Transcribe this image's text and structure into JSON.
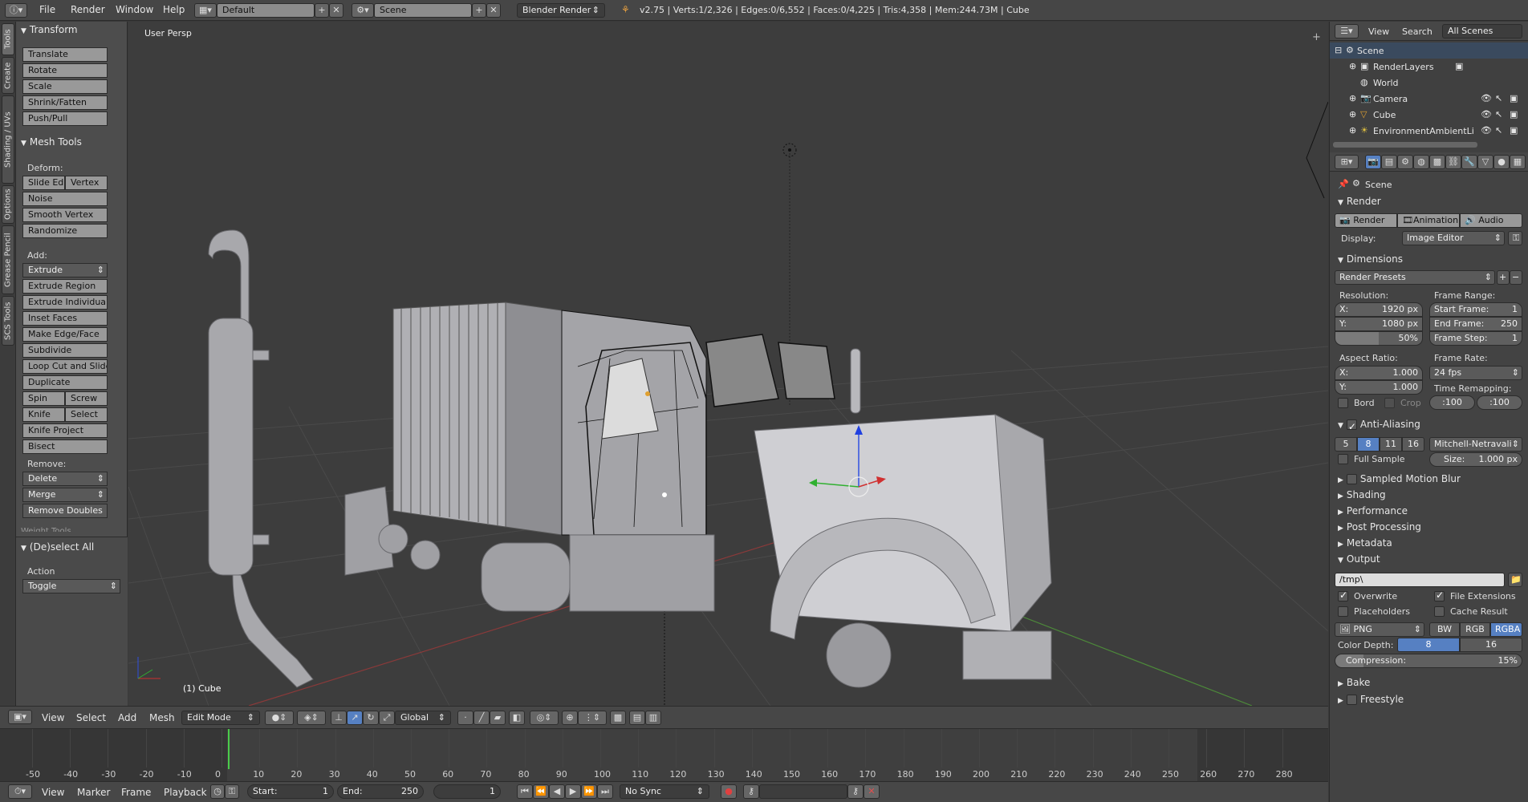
{
  "topbar": {
    "menus": [
      "File",
      "Render",
      "Window",
      "Help"
    ],
    "layout": "Default",
    "scene": "Scene",
    "engine": "Blender Render",
    "stats": "v2.75 | Verts:1/2,326 | Edges:0/6,552 | Faces:0/4,225 | Tris:4,358 | Mem:244.73M | Cube"
  },
  "lefttabs": [
    "Tools",
    "Create",
    "Shading / UVs",
    "Options",
    "Grease Pencil",
    "SCS Tools"
  ],
  "toolshelf": {
    "transform_title": "Transform",
    "transform": [
      "Translate",
      "Rotate",
      "Scale",
      "Shrink/Fatten",
      "Push/Pull"
    ],
    "mesh_title": "Mesh Tools",
    "deform_label": "Deform:",
    "slide_edge": "Slide Ed",
    "vertex": "Vertex",
    "deform": [
      "Noise",
      "Smooth Vertex",
      "Randomize"
    ],
    "add_label": "Add:",
    "extrude": "Extrude",
    "add": [
      "Extrude Region",
      "Extrude Individual",
      "Inset Faces",
      "Make Edge/Face",
      "Subdivide",
      "Loop Cut and Slide",
      "Duplicate"
    ],
    "spin": "Spin",
    "screw": "Screw",
    "knife": "Knife",
    "select": "Select",
    "knife_project": "Knife Project",
    "bisect": "Bisect",
    "remove_label": "Remove:",
    "delete": "Delete",
    "merge": "Merge",
    "remove_doubles": "Remove Doubles",
    "weight_tools": "Weight Tools",
    "op_title": "(De)select All",
    "action_label": "Action",
    "action_value": "Toggle"
  },
  "viewport": {
    "view_name": "User Persp",
    "object_label": "(1) Cube"
  },
  "vheader": {
    "menus": [
      "View",
      "Select",
      "Add",
      "Mesh"
    ],
    "mode": "Edit Mode",
    "orientation": "Global"
  },
  "timeline": {
    "ticks": [
      "-50",
      "-40",
      "-30",
      "-20",
      "-10",
      "0",
      "10",
      "20",
      "30",
      "40",
      "50",
      "60",
      "70",
      "80",
      "90",
      "100",
      "110",
      "120",
      "130",
      "140",
      "150",
      "160",
      "170",
      "180",
      "190",
      "200",
      "210",
      "220",
      "230",
      "240",
      "250",
      "260",
      "270",
      "280"
    ],
    "current_frame": 1
  },
  "tlheader": {
    "menus": [
      "View",
      "Marker",
      "Frame",
      "Playback"
    ],
    "start_label": "Start:",
    "start": "1",
    "end_label": "End:",
    "end": "250",
    "current": "1",
    "sync": "No Sync"
  },
  "outliner": {
    "menus": [
      "View",
      "Search"
    ],
    "filter": "All Scenes",
    "items": [
      "Scene",
      "RenderLayers",
      "World",
      "Camera",
      "Cube",
      "EnvironmentAmbientLi"
    ]
  },
  "props": {
    "scene_label": "Scene",
    "render_title": "Render",
    "render_btn": "Render",
    "animation_btn": "Animation",
    "audio_btn": "Audio",
    "display_label": "Display:",
    "display_value": "Image Editor",
    "dimensions_title": "Dimensions",
    "presets": "Render Presets",
    "resolution_label": "Resolution:",
    "res_x": "X:",
    "res_x_val": "1920 px",
    "res_y": "Y:",
    "res_y_val": "1080 px",
    "res_pct": "50%",
    "frame_range_label": "Frame Range:",
    "start_frame": "Start Frame:",
    "start_frame_val": "1",
    "end_frame": "End Frame:",
    "end_frame_val": "250",
    "frame_step": "Frame Step:",
    "frame_step_val": "1",
    "aspect_label": "Aspect Ratio:",
    "asp_x": "X:",
    "asp_x_val": "1.000",
    "asp_y": "Y:",
    "asp_y_val": "1.000",
    "frame_rate_label": "Frame Rate:",
    "fps": "24 fps",
    "time_remap_label": "Time Remapping:",
    "remap_old": ":100",
    "remap_new": ":100",
    "bord": "Bord",
    "crop": "Crop",
    "aa_title": "Anti-Aliasing",
    "aa_samples": [
      "5",
      "8",
      "11",
      "16"
    ],
    "aa_filter": "Mitchell-Netravali",
    "full_sample": "Full Sample",
    "size_label": "Size:",
    "size_val": "1.000 px",
    "collapsed": [
      "Sampled Motion Blur",
      "Shading",
      "Performance",
      "Post Processing",
      "Metadata"
    ],
    "output_title": "Output",
    "output_path": "/tmp\\",
    "overwrite": "Overwrite",
    "file_ext": "File Extensions",
    "placeholders": "Placeholders",
    "cache_result": "Cache Result",
    "format": "PNG",
    "color_modes": [
      "BW",
      "RGB",
      "RGBA"
    ],
    "color_depth_label": "Color Depth:",
    "depth_8": "8",
    "depth_16": "16",
    "compression_label": "Compression:",
    "compression_val": "15%",
    "bake_title": "Bake",
    "freestyle_title": "Freestyle"
  }
}
